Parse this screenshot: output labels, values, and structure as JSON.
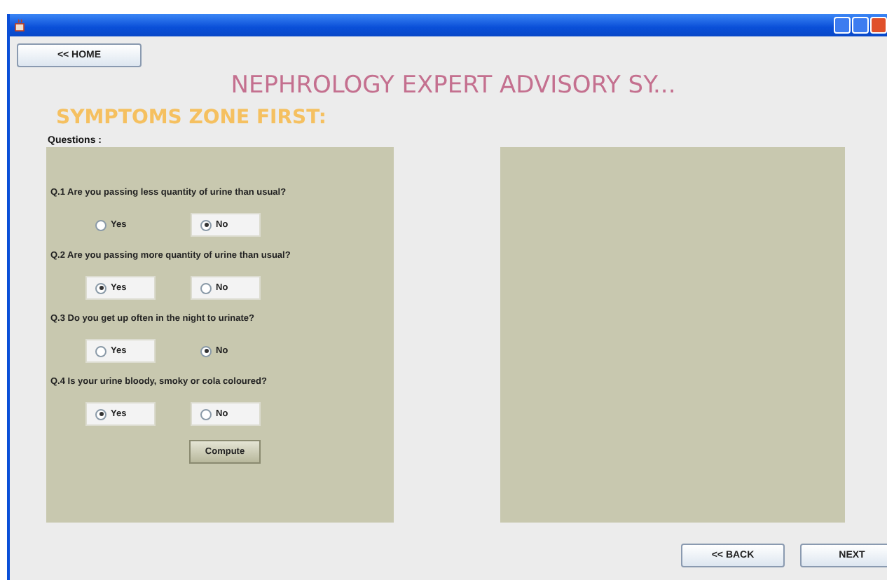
{
  "home_button": "<< HOME",
  "title": "NEPHROLOGY EXPERT ADVISORY SY...",
  "subtitle": "SYMPTOMS ZONE FIRST:",
  "questions_label": "Questions :",
  "questions": [
    {
      "text": "Q.1 Are you passing less quantity of urine than usual?",
      "options": [
        {
          "label": "Yes",
          "selected": false,
          "boxed": false
        },
        {
          "label": "No",
          "selected": true,
          "boxed": true
        }
      ]
    },
    {
      "text": "Q.2 Are you passing more quantity of urine than usual?",
      "options": [
        {
          "label": "Yes",
          "selected": true,
          "boxed": true
        },
        {
          "label": "No",
          "selected": false,
          "boxed": true
        }
      ]
    },
    {
      "text": "Q.3 Do you get up often in the night to urinate?",
      "options": [
        {
          "label": "Yes",
          "selected": false,
          "boxed": true
        },
        {
          "label": "No",
          "selected": true,
          "boxed": false
        }
      ]
    },
    {
      "text": "Q.4 Is your urine bloody, smoky or cola coloured?",
      "options": [
        {
          "label": "Yes",
          "selected": true,
          "boxed": true
        },
        {
          "label": "No",
          "selected": false,
          "boxed": true
        }
      ]
    }
  ],
  "compute_button": "Compute",
  "back_button": "<< BACK",
  "next_button": "NEXT"
}
